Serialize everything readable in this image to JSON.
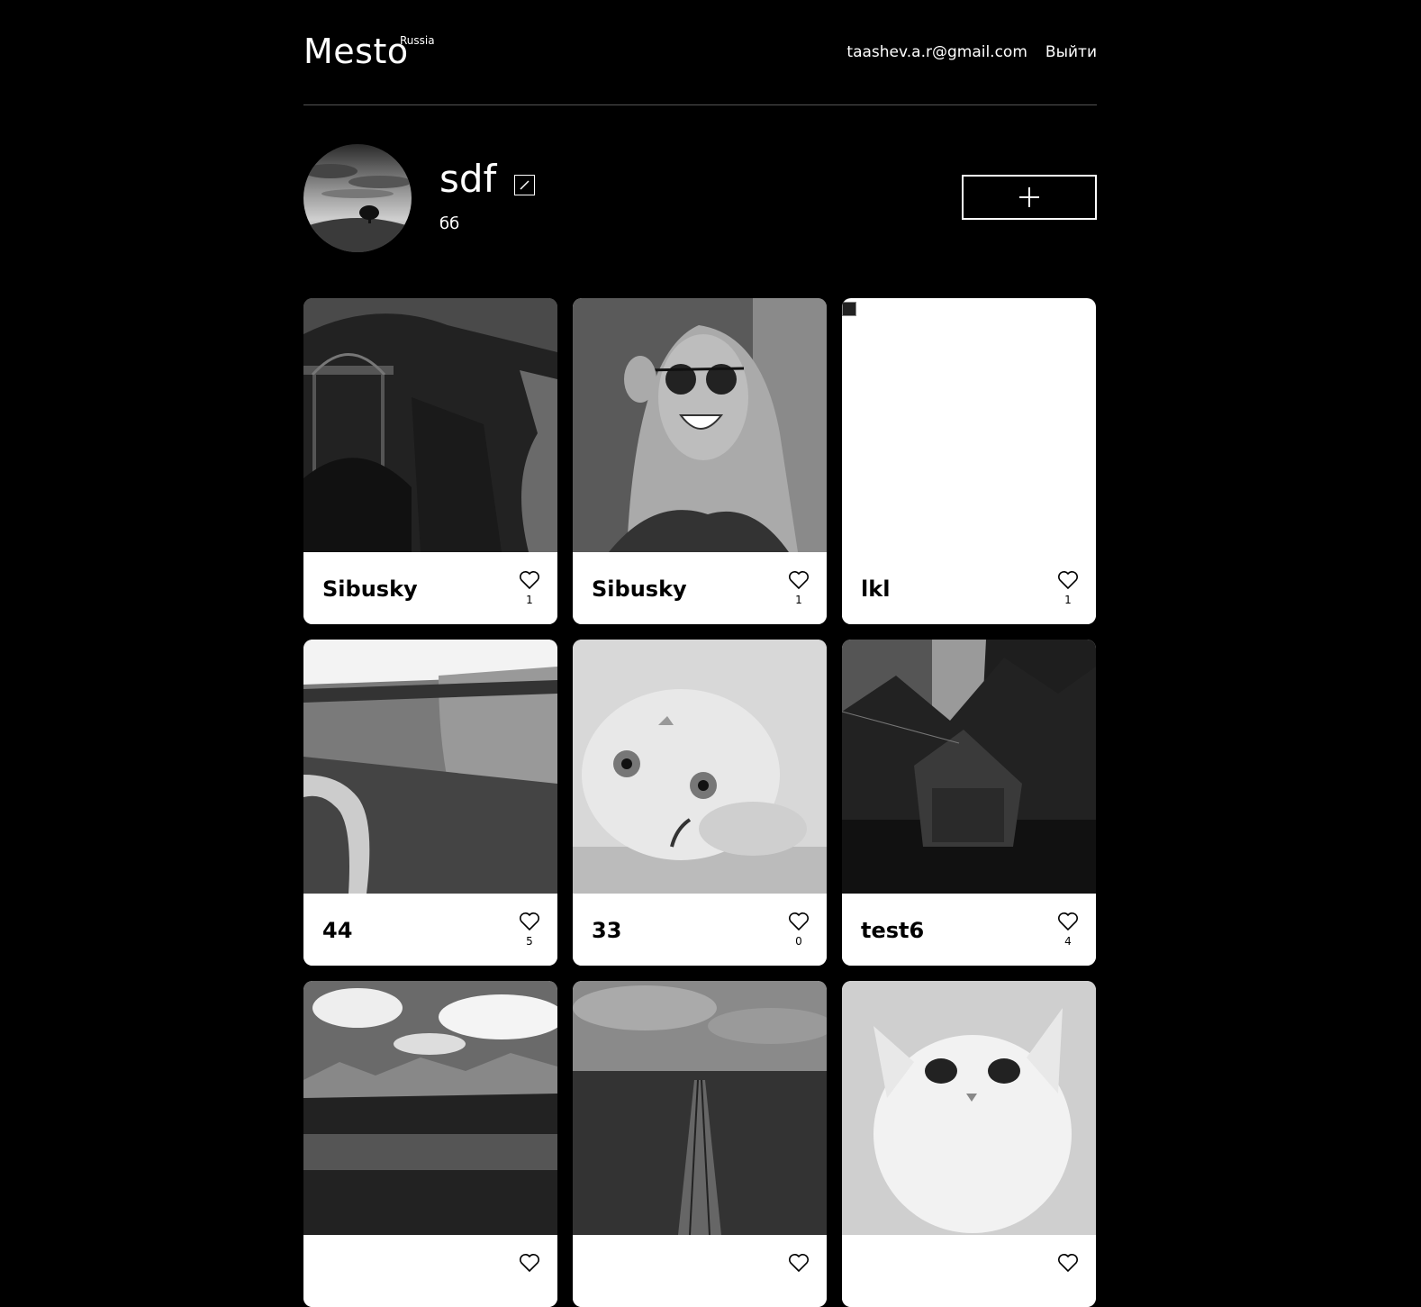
{
  "header": {
    "logo": "Mesto",
    "logo_sub": "Russia",
    "email": "taashev.a.r@gmail.com",
    "logout": "Выйти"
  },
  "profile": {
    "name": "sdf",
    "about": "бб",
    "avatar_icon": "landscape-tree-avatar",
    "edit_icon": "pencil-icon",
    "add_icon": "plus-icon"
  },
  "cards": [
    {
      "title": "Sibusky",
      "likes": "1",
      "image": "coastal-bridge-photo"
    },
    {
      "title": "Sibusky",
      "likes": "1",
      "image": "laughing-woman-photo"
    },
    {
      "title": "lkl",
      "likes": "1",
      "image": "broken-image",
      "alt": "lkl"
    },
    {
      "title": "44",
      "likes": "5",
      "image": "canyon-river-photo"
    },
    {
      "title": "33",
      "likes": "0",
      "image": "kitten-photo"
    },
    {
      "title": "test6",
      "likes": "4",
      "image": "forest-cabin-photo"
    },
    {
      "title": "",
      "likes": "",
      "image": "mountain-lake-photo"
    },
    {
      "title": "",
      "likes": "",
      "image": "railroad-forest-photo"
    },
    {
      "title": "",
      "likes": "",
      "image": "white-cat-photo"
    }
  ],
  "colors": {
    "background": "#000000",
    "card": "#ffffff",
    "divider": "#545454"
  }
}
